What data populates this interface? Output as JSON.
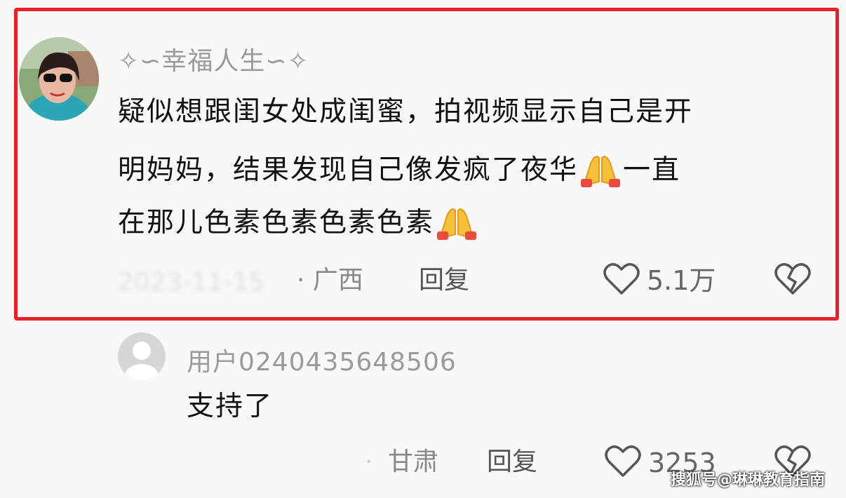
{
  "comment1": {
    "username": "幸福人生",
    "lines": [
      "疑似想跟闺女处成闺蜜，拍视频显示自己是开",
      "明妈妈，结果发现自己像发疯了夜华",
      "一直",
      "在那儿色素色素色素色素"
    ],
    "date_blurred": "2023-11-15",
    "location": "· 广西",
    "reply_label": "回复",
    "likes": "5.1万"
  },
  "comment2": {
    "username": "用户0240435648506",
    "text": "支持了",
    "location": "甘肃",
    "reply_label": "回复",
    "likes": "3253"
  },
  "watermark": "搜狐号@琳琳教育指南",
  "icons": [
    "avatar-photo",
    "avatar-default",
    "pray-emoji",
    "heart-outline",
    "broken-heart"
  ]
}
